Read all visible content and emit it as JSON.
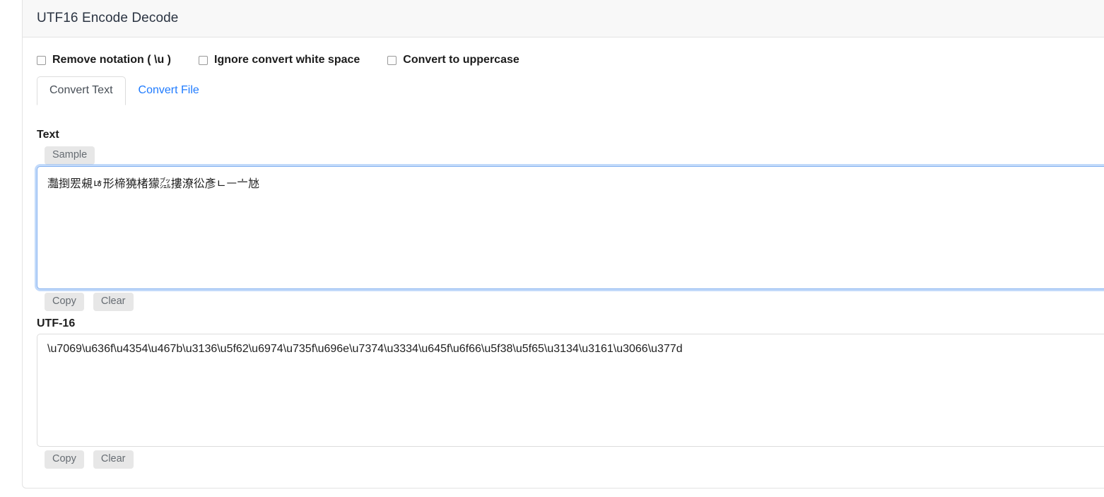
{
  "card": {
    "title": "UTF16 Encode Decode"
  },
  "options": [
    {
      "name": "remove-notation",
      "label": "Remove notation ( \\u )",
      "checked": false
    },
    {
      "name": "ignore-whitespace",
      "label": "Ignore convert white space",
      "checked": false
    },
    {
      "name": "convert-uppercase",
      "label": "Convert to uppercase",
      "checked": false
    }
  ],
  "tabs": [
    {
      "name": "convert-text",
      "label": "Convert Text",
      "active": true
    },
    {
      "name": "convert-file",
      "label": "Convert File",
      "active": false
    }
  ],
  "text_section": {
    "label": "Text",
    "sample_button": "Sample",
    "value": "灩捯䍔䙻ㄶ形楴獟楮獴㌴摟潦彸彥ㄴㅡ〦㝽",
    "copy_button": "Copy",
    "clear_button": "Clear"
  },
  "utf16_section": {
    "label": "UTF-16",
    "value": "\\u7069\\u636f\\u4354\\u467b\\u3136\\u5f62\\u6974\\u735f\\u696e\\u7374\\u3334\\u645f\\u6f66\\u5f38\\u5f65\\u3134\\u3161\\u3066\\u377d",
    "copy_button": "Copy",
    "clear_button": "Clear"
  },
  "colors": {
    "link": "#1f7bff",
    "header_bg": "#f8f8f8",
    "border": "#e3e3e3",
    "focus_ring": "#86b2f0",
    "button_bg": "#e7e7e7"
  }
}
